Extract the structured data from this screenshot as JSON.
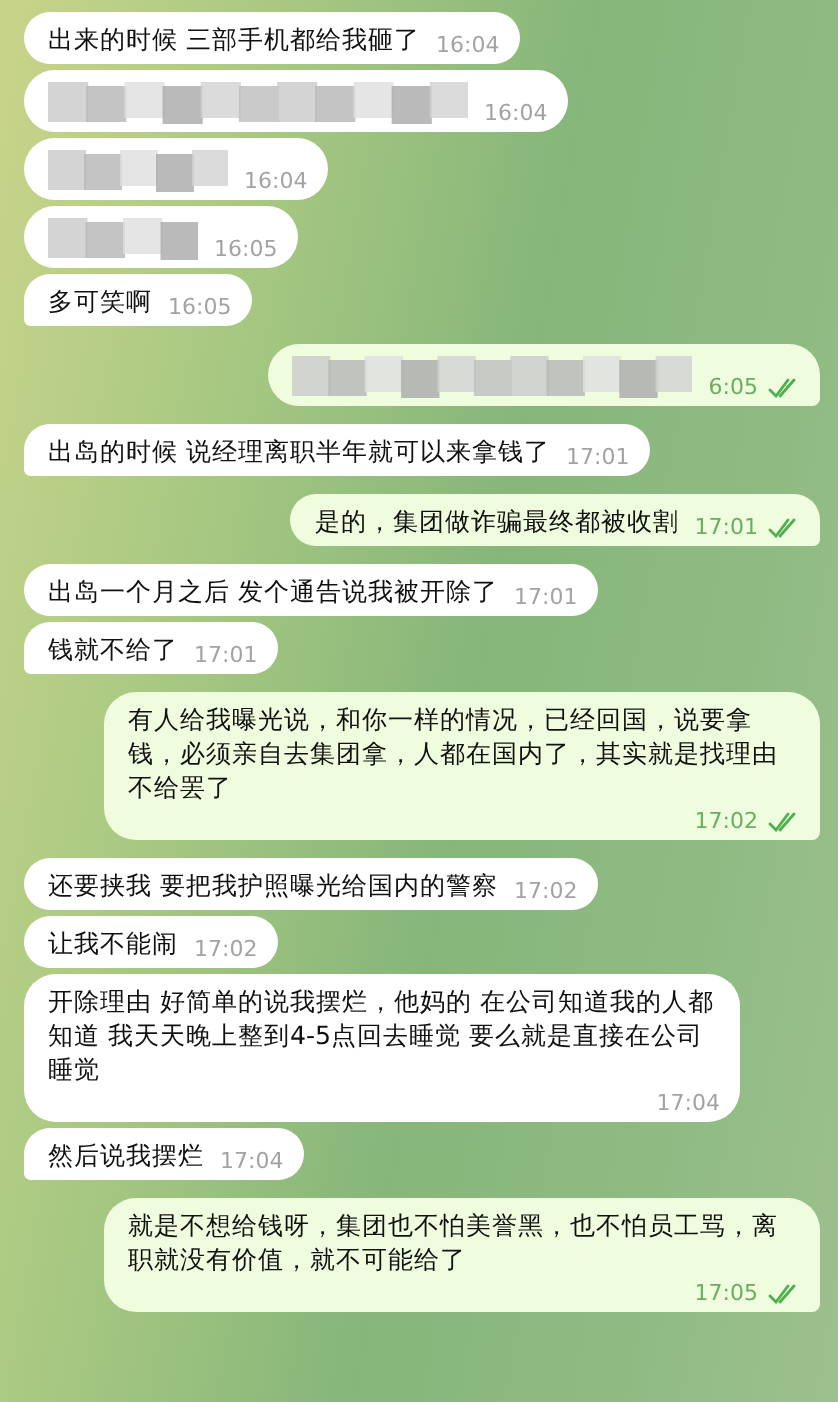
{
  "messages": [
    {
      "outgoing": false,
      "kind": "text",
      "text": "出来的时候 三部手机都给我砸了",
      "time": "16:04",
      "tail": false
    },
    {
      "outgoing": false,
      "kind": "blurred",
      "time": "16:04",
      "tail": false
    },
    {
      "outgoing": false,
      "kind": "blurred",
      "time": "16:04",
      "tail": false
    },
    {
      "outgoing": false,
      "kind": "blurred",
      "time": "16:05",
      "tail": false
    },
    {
      "outgoing": false,
      "kind": "text",
      "text": "多可笑啊",
      "time": "16:05",
      "tail": true
    },
    {
      "outgoing": true,
      "kind": "blurred",
      "time": "6:05",
      "read": true,
      "tail": true
    },
    {
      "outgoing": false,
      "kind": "text",
      "text": "出岛的时候 说经理离职半年就可以来拿钱了",
      "time": "17:01",
      "tail": true
    },
    {
      "outgoing": true,
      "kind": "text",
      "text": "是的，集团做诈骗最终都被收割",
      "time": "17:01",
      "read": true,
      "tail": true
    },
    {
      "outgoing": false,
      "kind": "text",
      "text": "出岛一个月之后 发个通告说我被开除了",
      "time": "17:01",
      "tail": false
    },
    {
      "outgoing": false,
      "kind": "text",
      "text": "钱就不给了",
      "time": "17:01",
      "tail": true
    },
    {
      "outgoing": true,
      "kind": "text",
      "text": "有人给我曝光说，和你一样的情况，已经回国，说要拿钱，必须亲自去集团拿，人都在国内了，其实就是找理由不给罢了",
      "time": "17:02",
      "read": true,
      "tail": true
    },
    {
      "outgoing": false,
      "kind": "text",
      "text": "还要挟我 要把我护照曝光给国内的警察",
      "time": "17:02",
      "tail": false
    },
    {
      "outgoing": false,
      "kind": "text",
      "text": "让我不能闹",
      "time": "17:02",
      "tail": false
    },
    {
      "outgoing": false,
      "kind": "text",
      "text": "开除理由 好简单的说我摆烂，他妈的  在公司知道我的人都知道 我天天晚上整到4-5点回去睡觉 要么就是直接在公司睡觉",
      "time": "17:04",
      "tail": false
    },
    {
      "outgoing": false,
      "kind": "text",
      "text": "然后说我摆烂",
      "time": "17:04",
      "tail": true
    },
    {
      "outgoing": true,
      "kind": "text",
      "text": "就是不想给钱呀，集团也不怕美誉黑，也不怕员工骂，离职就没有价值，就不可能给了",
      "time": "17:05",
      "read": true,
      "tail": true
    }
  ]
}
